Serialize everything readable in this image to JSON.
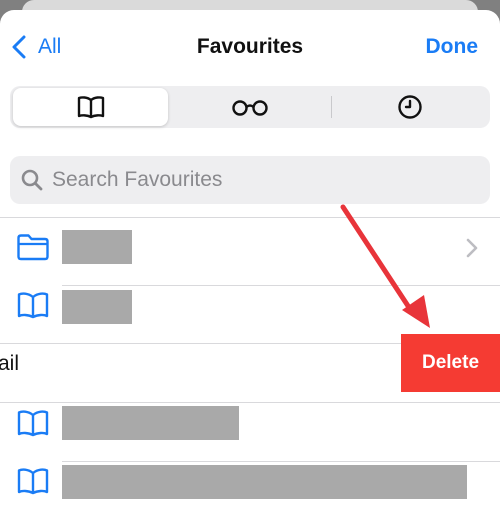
{
  "nav": {
    "back_label": "All",
    "title": "Favourites",
    "done_label": "Done"
  },
  "segments": [
    {
      "icon": "book-icon",
      "active": true
    },
    {
      "icon": "reading-glasses-icon",
      "active": false
    },
    {
      "icon": "clock-icon",
      "active": false
    }
  ],
  "search": {
    "placeholder": "Search Favourites",
    "value": ""
  },
  "list": {
    "items": [
      {
        "icon": "folder-icon",
        "label_redacted": true,
        "has_chevron": true
      },
      {
        "icon": "book-icon",
        "label_redacted": true
      },
      {
        "label_visible": "ail",
        "swiped": true
      },
      {
        "icon": "book-icon",
        "label_redacted": true
      },
      {
        "icon": "book-icon",
        "label_redacted": true
      }
    ],
    "delete_label": "Delete"
  },
  "colors": {
    "accent": "#1a7cf5",
    "delete": "#f53b33",
    "annotation_arrow": "#e8343a",
    "redaction": "#a9a9a9"
  }
}
